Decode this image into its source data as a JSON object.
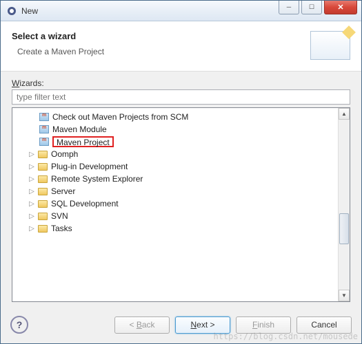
{
  "window": {
    "title": "New"
  },
  "header": {
    "title": "Select a wizard",
    "desc": "Create a Maven Project"
  },
  "body": {
    "wizards_label": "Wizards:",
    "filter_placeholder": "type filter text",
    "items": [
      {
        "label": "Check out Maven Projects from SCM",
        "type": "leaf",
        "icon": "maven"
      },
      {
        "label": "Maven Module",
        "type": "leaf",
        "icon": "maven"
      },
      {
        "label": "Maven Project",
        "type": "leaf",
        "icon": "maven",
        "highlighted": true
      },
      {
        "label": "Oomph",
        "type": "folder"
      },
      {
        "label": "Plug-in Development",
        "type": "folder"
      },
      {
        "label": "Remote System Explorer",
        "type": "folder"
      },
      {
        "label": "Server",
        "type": "folder"
      },
      {
        "label": "SQL Development",
        "type": "folder"
      },
      {
        "label": "SVN",
        "type": "folder"
      },
      {
        "label": "Tasks",
        "type": "folder"
      }
    ]
  },
  "buttons": {
    "back": "< Back",
    "next": "Next >",
    "finish": "Finish",
    "cancel": "Cancel"
  },
  "watermark": "https://blog.csdn.net/mousede"
}
